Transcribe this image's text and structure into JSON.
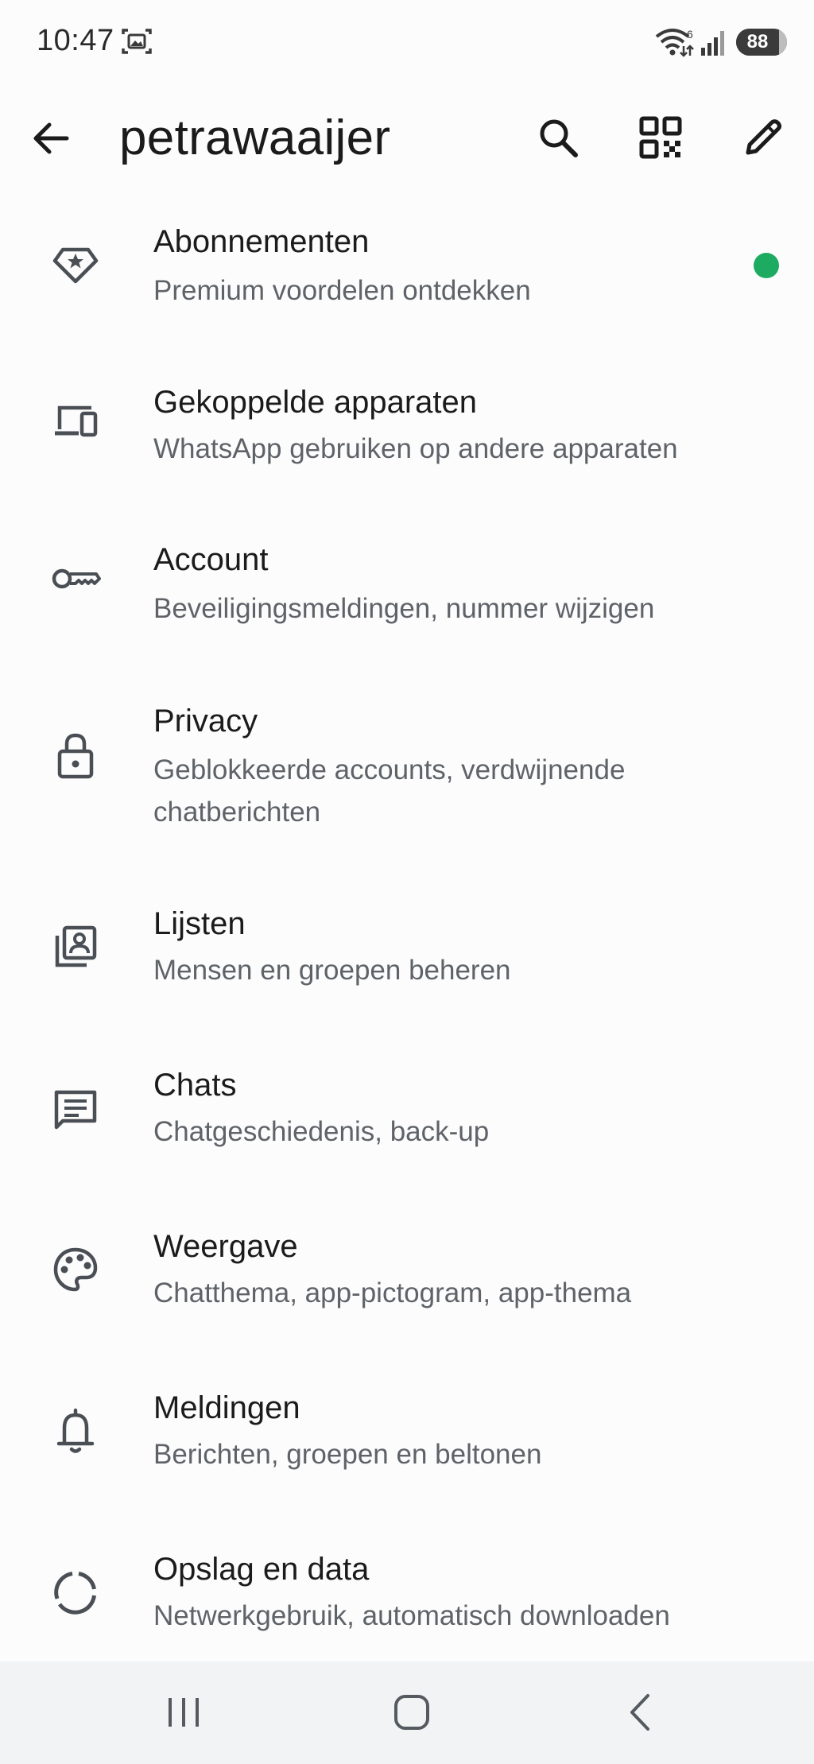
{
  "status_bar": {
    "time": "10:47",
    "battery_level": "88",
    "battery_fraction": 0.88,
    "wifi_badge": "6"
  },
  "app_bar": {
    "title": "petrawaaijer",
    "icons": [
      "back-arrow-icon",
      "search-icon",
      "qr-code-icon",
      "pencil-icon"
    ]
  },
  "settings": [
    {
      "title": "Abonnementen",
      "subtitle": "Premium voordelen ontdekken",
      "icon": "premium-badge-icon",
      "badge_color": "#1daa61"
    },
    {
      "title": "Gekoppelde apparaten",
      "subtitle": "WhatsApp gebruiken op andere apparaten",
      "icon": "devices-icon"
    },
    {
      "title": "Account",
      "subtitle": "Beveiligingsmeldingen, nummer wijzigen",
      "icon": "key-icon"
    },
    {
      "title": "Privacy",
      "subtitle_line1": "Geblokkeerde accounts, verdwijnende",
      "subtitle_line2": "chatberichten",
      "icon": "lock-icon"
    },
    {
      "title": "Lijsten",
      "subtitle": "Mensen en groepen beheren",
      "icon": "contact-list-icon"
    },
    {
      "title": "Chats",
      "subtitle": "Chatgeschiedenis, back-up",
      "icon": "chat-message-icon"
    },
    {
      "title": "Weergave",
      "subtitle": "Chatthema, app-pictogram, app-thema",
      "icon": "palette-icon"
    },
    {
      "title": "Meldingen",
      "subtitle": "Berichten, groepen en beltonen",
      "icon": "bell-icon"
    },
    {
      "title": "Opslag en data",
      "subtitle": "Netwerkgebruik, automatisch downloaden",
      "icon": "data-usage-icon"
    }
  ],
  "colors": {
    "background": "#fcfcfd",
    "text_primary": "#1b1b1b",
    "text_secondary": "#5f6368",
    "icon": "#4a4f55",
    "accent_green": "#1daa61",
    "nav_bar": "#f2f3f5"
  }
}
